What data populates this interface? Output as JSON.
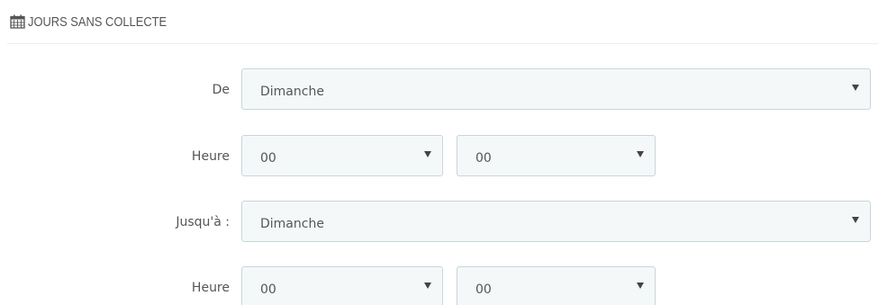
{
  "section": {
    "title": "JOURS SANS COLLECTE",
    "icon": "calendar-icon"
  },
  "from": {
    "day_label": "De",
    "day_value": "Dimanche",
    "hour_label": "Heure",
    "hour_value": "00",
    "minute_value": "00"
  },
  "to": {
    "day_label": "Jusqu'à :",
    "day_value": "Dimanche",
    "hour_label": "Heure",
    "hour_value": "00",
    "minute_value": "00"
  },
  "colors": {
    "select_bg": "#f5f8f9",
    "select_border": "#c7d6db",
    "text": "#555555"
  }
}
